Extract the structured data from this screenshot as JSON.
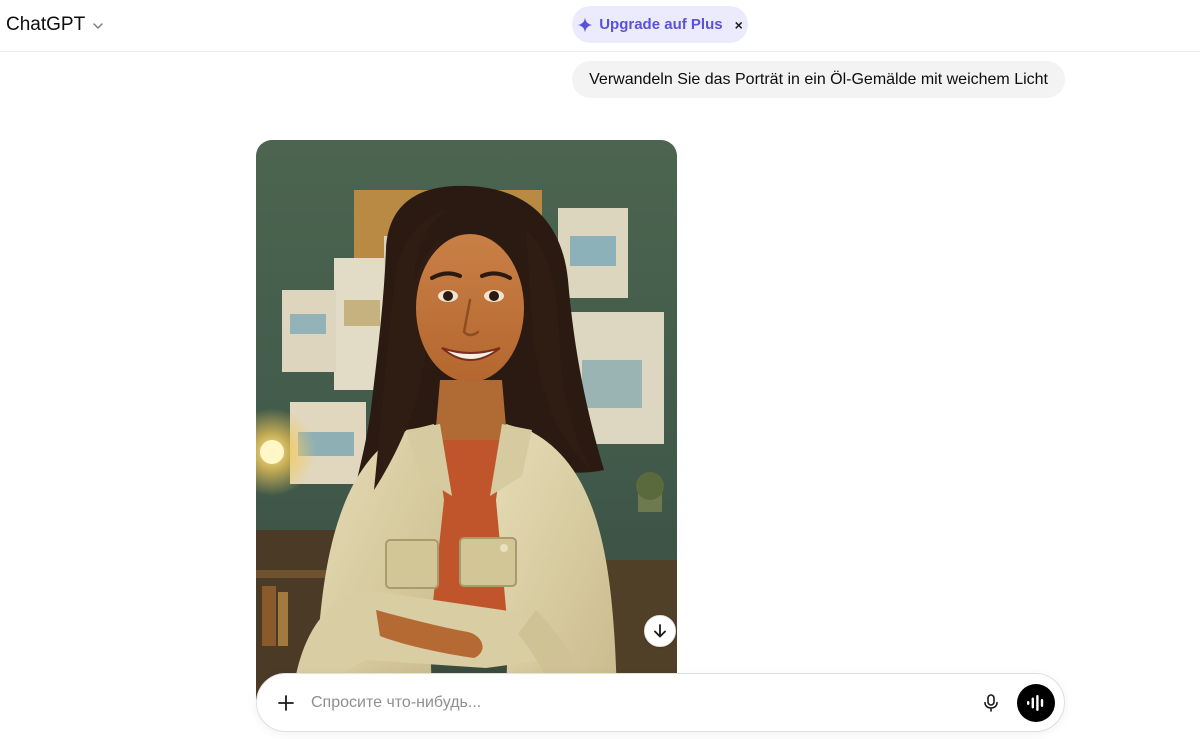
{
  "header": {
    "model_name": "ChatGPT",
    "upgrade_label": "Upgrade auf Plus",
    "upgrade_close": "×"
  },
  "conversation": {
    "user_message": "Verwandeln Sie das Porträt in ein Öl-Gemälde mit weichem Licht",
    "generated_image": {
      "subject": "oil-painting portrait of a smiling woman with long dark hair in a light denim jacket, arms crossed, soft warm light"
    }
  },
  "composer": {
    "placeholder": "Спросите что-нибудь...",
    "value": ""
  },
  "icons": {
    "model_dropdown": "chevron-down-icon",
    "upgrade": "sparkle-icon",
    "scroll": "arrow-down-icon",
    "attach": "plus-icon",
    "dictate": "microphone-icon",
    "voice": "voice-waveform-icon"
  },
  "colors": {
    "upgrade_bg": "#ebebfd",
    "upgrade_text": "#5b52d6",
    "bubble_bg": "#f3f3f3",
    "voice_button": "#000000"
  }
}
